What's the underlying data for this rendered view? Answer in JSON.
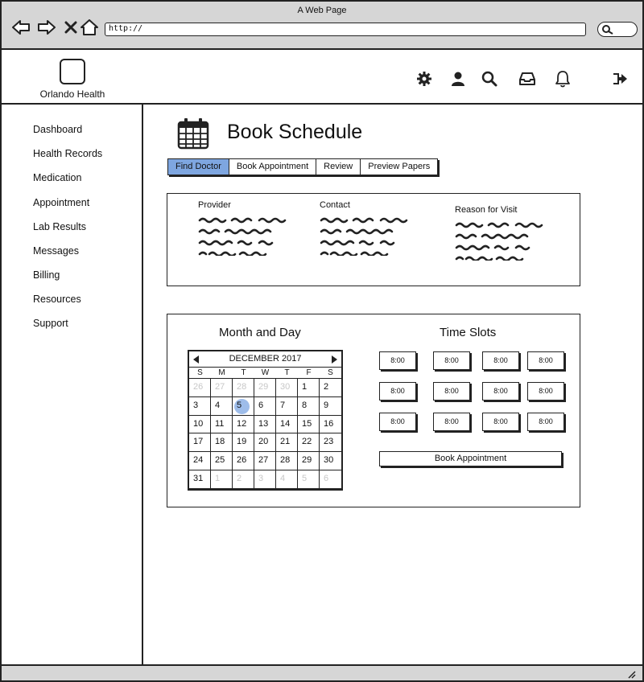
{
  "browser": {
    "title": "A Web Page",
    "url": "http://"
  },
  "app": {
    "brand": "Orlando Health",
    "header_icons": [
      "gear-icon",
      "user-icon",
      "search-icon",
      "inbox-icon",
      "bell-icon",
      "sign-out-icon"
    ]
  },
  "sidebar": {
    "items": [
      {
        "label": "Dashboard"
      },
      {
        "label": "Health Records"
      },
      {
        "label": "Medication"
      },
      {
        "label": "Appointment"
      },
      {
        "label": "Lab Results"
      },
      {
        "label": "Messages"
      },
      {
        "label": "Billing"
      },
      {
        "label": "Resources"
      },
      {
        "label": "Support"
      }
    ]
  },
  "main": {
    "title": "Book Schedule",
    "tabs": [
      {
        "label": "Find Doctor",
        "active": true
      },
      {
        "label": "Book Appointment",
        "active": false
      },
      {
        "label": "Review",
        "active": false
      },
      {
        "label": "Preview Papers",
        "active": false
      }
    ],
    "info": {
      "provider_label": "Provider",
      "contact_label": "Contact",
      "reason_label": "Reason for Visit"
    },
    "booking": {
      "date_heading": "Month and Day",
      "slots_heading": "Time Slots",
      "calendar": {
        "month_label": "DECEMBER 2017",
        "weekdays": [
          "S",
          "M",
          "T",
          "W",
          "T",
          "F",
          "S"
        ],
        "days": [
          {
            "d": "26",
            "muted": true
          },
          {
            "d": "27",
            "muted": true
          },
          {
            "d": "28",
            "muted": true
          },
          {
            "d": "29",
            "muted": true
          },
          {
            "d": "30",
            "muted": true
          },
          {
            "d": "1"
          },
          {
            "d": "2"
          },
          {
            "d": "3"
          },
          {
            "d": "4"
          },
          {
            "d": "5",
            "selected": true
          },
          {
            "d": "6"
          },
          {
            "d": "7"
          },
          {
            "d": "8"
          },
          {
            "d": "9"
          },
          {
            "d": "10"
          },
          {
            "d": "11"
          },
          {
            "d": "12"
          },
          {
            "d": "13"
          },
          {
            "d": "14"
          },
          {
            "d": "15"
          },
          {
            "d": "16"
          },
          {
            "d": "17"
          },
          {
            "d": "18"
          },
          {
            "d": "19"
          },
          {
            "d": "20"
          },
          {
            "d": "21"
          },
          {
            "d": "22"
          },
          {
            "d": "23"
          },
          {
            "d": "24"
          },
          {
            "d": "25"
          },
          {
            "d": "26"
          },
          {
            "d": "27"
          },
          {
            "d": "28"
          },
          {
            "d": "29"
          },
          {
            "d": "30"
          },
          {
            "d": "31"
          },
          {
            "d": "1",
            "muted": true
          },
          {
            "d": "2",
            "muted": true
          },
          {
            "d": "3",
            "muted": true
          },
          {
            "d": "4",
            "muted": true
          },
          {
            "d": "5",
            "muted": true
          },
          {
            "d": "6",
            "muted": true
          }
        ]
      },
      "slots": [
        "8:00",
        "8:00",
        "8:00",
        "8:00",
        "8:00",
        "8:00",
        "8:00",
        "8:00",
        "8:00",
        "8:00",
        "8:00",
        "8:00"
      ],
      "book_button": "Book Appointment"
    }
  },
  "colors": {
    "accent": "#7ea6e0",
    "selected_day": "#9ebdea",
    "chrome": "#d6d6d6"
  }
}
